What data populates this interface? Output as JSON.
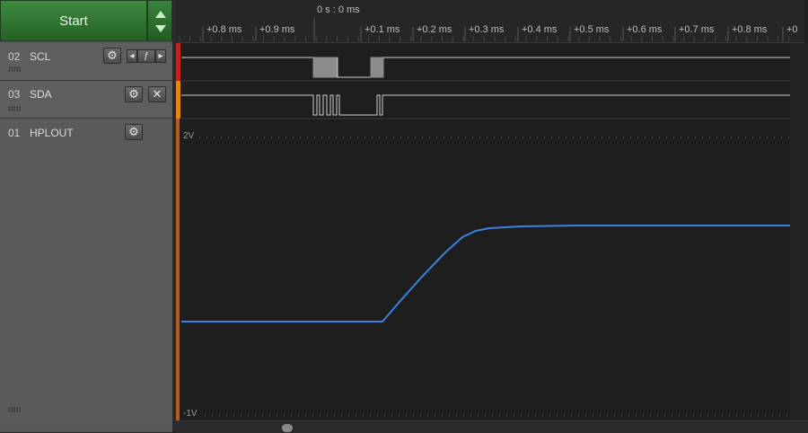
{
  "toolbar": {
    "start_label": "Start"
  },
  "timeline": {
    "origin_label": "0 s : 0 ms",
    "ticks": [
      "+0.8 ms",
      "+0.9 ms",
      "+0.1 ms",
      "+0.2 ms",
      "+0.3 ms",
      "+0.4 ms",
      "+0.5 ms",
      "+0.6 ms",
      "+0.7 ms",
      "+0.8 ms",
      "+0"
    ]
  },
  "channels": [
    {
      "number": "02",
      "name": "SCL",
      "settings_icon": "gear-icon",
      "trigger_icon": "falling-edge-icon"
    },
    {
      "number": "03",
      "name": "SDA",
      "settings_icon": "gear-icon",
      "close_icon": "close-icon"
    },
    {
      "number": "01",
      "name": "HPLOUT",
      "settings_icon": "gear-icon"
    }
  ],
  "analog": {
    "top_label": "2V",
    "bottom_label": "-1V",
    "trace_color": "#3b82e0"
  }
}
